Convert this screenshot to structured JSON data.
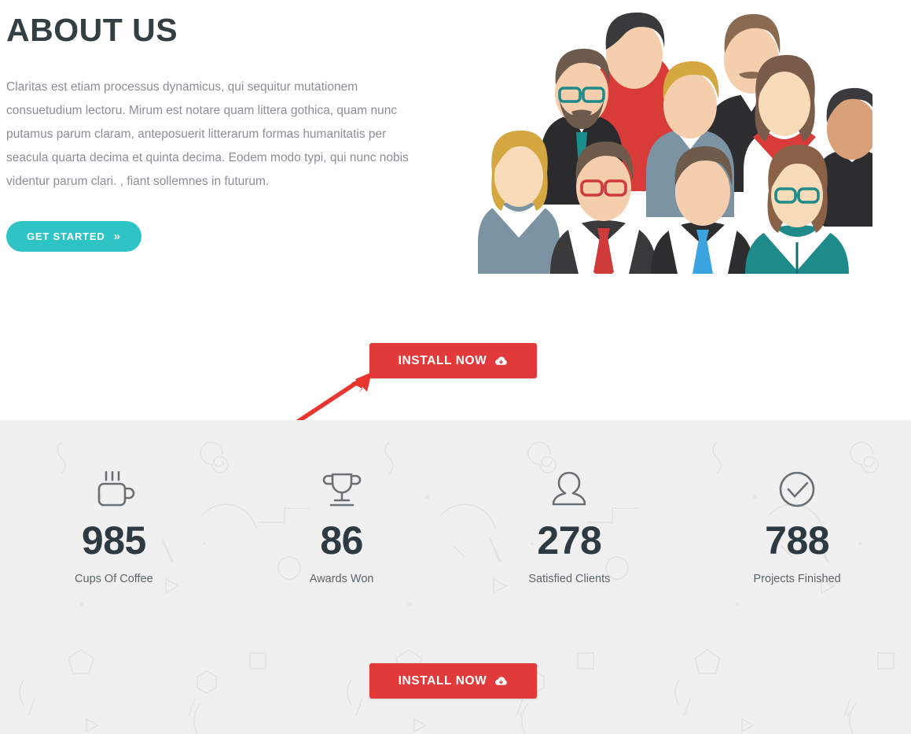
{
  "about": {
    "title": "ABOUT US",
    "paragraph": "Claritas est etiam processus dynamicus, qui sequitur mutationem consuetudium lectoru. Mirum est notare quam littera gothica, quam nunc putamus parum claram, anteposuerit litterarum formas humanitatis per seacula quarta decima et quinta decima. Eodem modo typi, qui nunc nobis videntur parum clari. , fiant sollemnes in futurum.",
    "get_started_label": "GET STARTED",
    "get_started_chevron": "»",
    "illustration_name": "team-group-illustration"
  },
  "install_top": {
    "label": "INSTALL NOW",
    "icon": "cloud-download-icon"
  },
  "install_bottom": {
    "label": "INSTALL NOW",
    "icon": "cloud-download-icon"
  },
  "annotation": {
    "name": "red-arrow-pointer",
    "color": "#e8352f"
  },
  "counters": [
    {
      "icon": "coffee-cup-icon",
      "value": "985",
      "label": "Cups Of Coffee"
    },
    {
      "icon": "trophy-icon",
      "value": "86",
      "label": "Awards Won"
    },
    {
      "icon": "user-icon",
      "value": "278",
      "label": "Satisfied Clients"
    },
    {
      "icon": "check-circle-icon",
      "value": "788",
      "label": "Projects Finished"
    }
  ],
  "colors": {
    "heading": "#343f44",
    "body_text": "#8a8f94",
    "accent_teal": "#2ec4c6",
    "accent_red": "#e23a3a",
    "counter_bg": "#f0f0f0",
    "counter_number": "#2d3a41",
    "counter_icon": "#6b7074"
  }
}
